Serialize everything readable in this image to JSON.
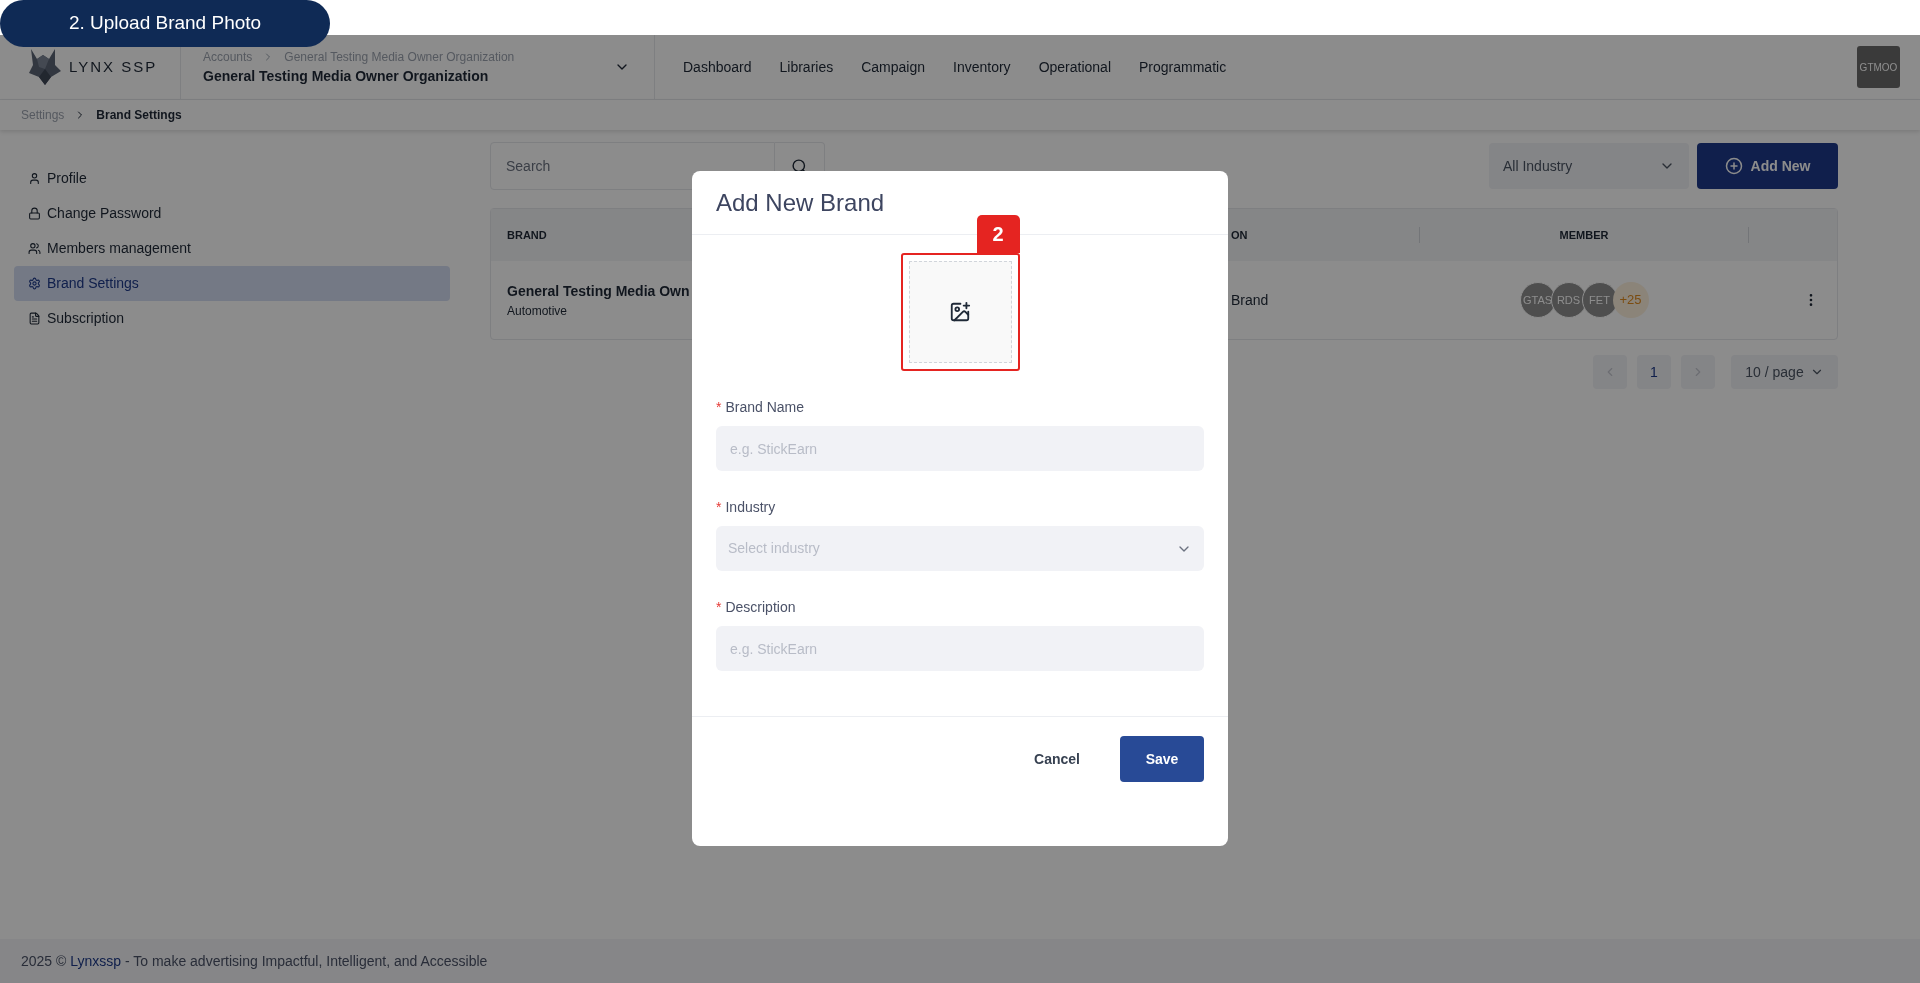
{
  "tutorial": {
    "step_label": "2. Upload Brand Photo",
    "marker": "2"
  },
  "header": {
    "logo_text": "LYNX SSP",
    "path": [
      "Accounts",
      "General Testing Media Owner Organization"
    ],
    "organization": "General Testing Media Owner Organization",
    "nav": [
      "Dashboard",
      "Libraries",
      "Campaign",
      "Inventory",
      "Operational",
      "Programmatic"
    ],
    "avatar": "GTMOO"
  },
  "breadcrumb": [
    {
      "label": "Settings",
      "selected": false
    },
    {
      "label": "Brand Settings",
      "selected": true
    }
  ],
  "sidebar": {
    "items": [
      {
        "label": "Profile",
        "selected": false
      },
      {
        "label": "Change Password",
        "selected": false
      },
      {
        "label": "Members management",
        "selected": false
      },
      {
        "label": "Brand Settings",
        "selected": true
      },
      {
        "label": "Subscription",
        "selected": false
      }
    ]
  },
  "toolbar": {
    "search_placeholder": "Search",
    "industry_filter": "All Industry",
    "add_button": "Add New"
  },
  "table": {
    "columns": [
      "BRAND",
      "ON",
      "MEMBER"
    ],
    "rows": [
      {
        "brand": "General Testing Media Own",
        "industry": "Automotive",
        "column_2": "Brand",
        "members": [
          "GTAS",
          "RDS",
          "FET"
        ],
        "more_members": "+25"
      }
    ]
  },
  "pagination": {
    "pages": [
      {
        "label": "1",
        "selected": true
      }
    ],
    "page_size": "10 / page"
  },
  "modal": {
    "title": "Add New Brand",
    "fields": [
      {
        "kind": "text",
        "label": "Brand Name",
        "required": true,
        "placeholder": "e.g. StickEarn"
      },
      {
        "kind": "select",
        "label": "Industry",
        "required": true,
        "placeholder": "Select industry"
      },
      {
        "kind": "text",
        "label": "Description",
        "required": true,
        "placeholder": "e.g. StickEarn"
      }
    ],
    "required_mark": "*",
    "cancel": "Cancel",
    "save": "Save"
  },
  "footer": {
    "prefix": "2025 ©",
    "link": "Lynxssp",
    "tagline": "- To make advertising Impactful, Intelligent, and Accessible"
  }
}
